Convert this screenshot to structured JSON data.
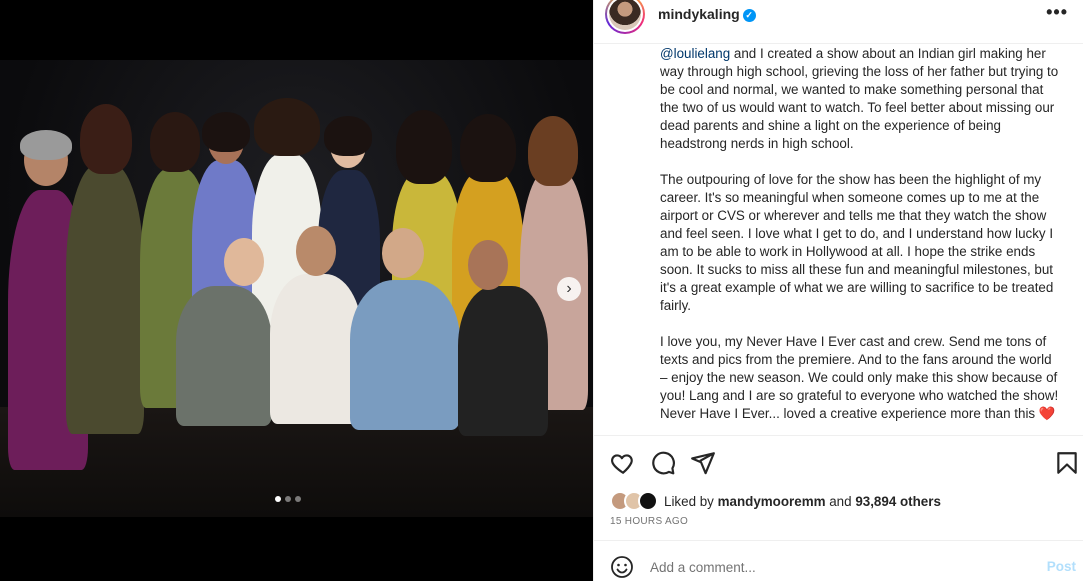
{
  "post": {
    "username": "mindykaling",
    "verified_symbol": "✓",
    "more_label": "•••",
    "caption": {
      "mention": "@loulielang",
      "p1_rest": " and I created a show about an Indian girl making her way through high school, grieving the loss of her father but trying to be cool and normal, we wanted to make something personal that the two of us would want to watch. To feel better about missing our dead parents and shine a light on the experience of being headstrong nerds in high school.",
      "p2": "The outpouring of love for the show has been the highlight of my career. It's so meaningful when someone comes up to me at the airport or CVS or wherever and tells me that they watch the show and feel seen. I love what I get to do, and I understand how lucky I am to be able to work in Hollywood at all. I hope the strike ends soon. It sucks to miss all these fun and meaningful milestones, but it's a great example of what we are willing to sacrifice to be treated fairly.",
      "p3": "I love you, my Never Have I Ever cast and crew. Send me tons of texts and pics from the premiere. And to the fans around the world – enjoy the new season. We could only make this show because of you! Lang and I are so grateful to everyone who watched the show! Never Have I Ever... loved a creative experience more than this ",
      "heart": "❤️"
    },
    "likes": {
      "prefix": "Liked by ",
      "user": "mandymooremm",
      "middle": " and ",
      "count": "93,894 others"
    },
    "timestamp": "15 HOURS AGO",
    "comment": {
      "placeholder": "Add a comment...",
      "post_label": "Post"
    },
    "carousel": {
      "next_symbol": "›",
      "slide_count": 3,
      "active_slide": 1
    }
  },
  "colors": {
    "accent": "#0095f6",
    "post_disabled": "#b2dffc",
    "mention": "#00376b",
    "heart": "#ed4956"
  },
  "icons": [
    "more-icon",
    "heart-icon",
    "comment-icon",
    "share-icon",
    "bookmark-icon",
    "emoji-icon",
    "chevron-right-icon",
    "verified-icon"
  ]
}
